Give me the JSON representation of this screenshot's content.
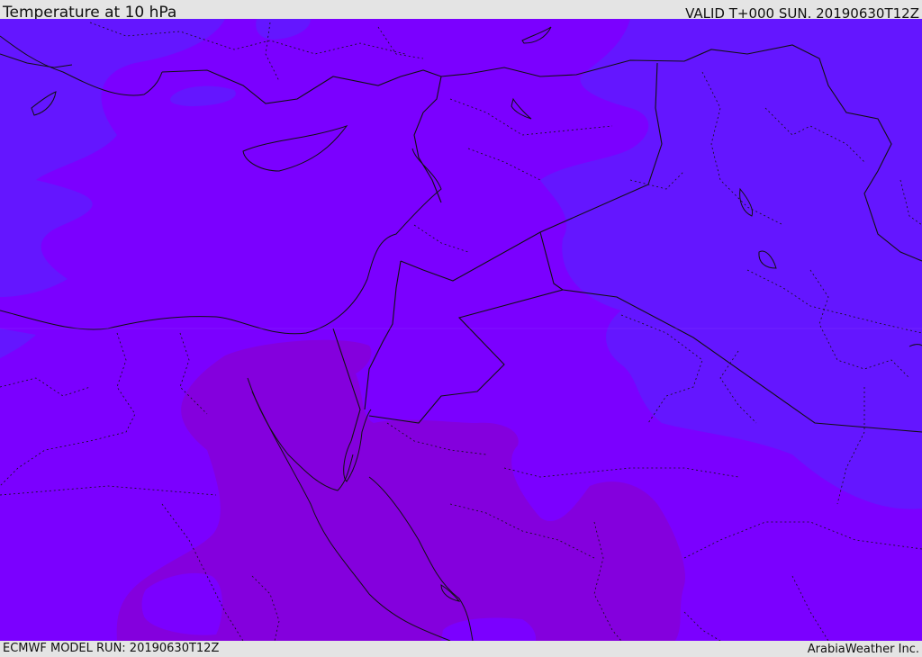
{
  "header": {
    "title": "Temperature at 10 hPa",
    "valid": "VALID T+000 SUN. 20190630T12Z"
  },
  "footer": {
    "model_run": "ECMWF MODEL RUN: 20190630T12Z",
    "credit": "ArabiaWeather Inc."
  },
  "colors": {
    "base": "#7b00ff",
    "cool": "#6416ff",
    "warm": "#8400dd",
    "border": "#111111"
  }
}
